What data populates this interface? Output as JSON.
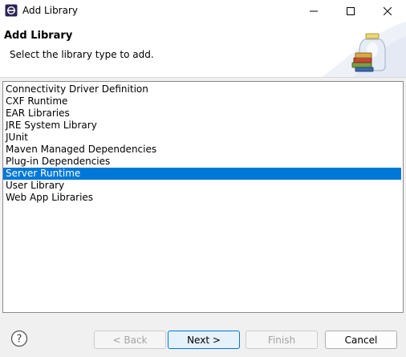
{
  "window": {
    "title": "Add Library",
    "icon": "eclipse-icon"
  },
  "banner": {
    "title": "Add Library",
    "description": "Select the library type to add.",
    "image": "books-jar-icon"
  },
  "library_types": [
    {
      "label": "Connectivity Driver Definition",
      "selected": false
    },
    {
      "label": "CXF Runtime",
      "selected": false
    },
    {
      "label": "EAR Libraries",
      "selected": false
    },
    {
      "label": "JRE System Library",
      "selected": false
    },
    {
      "label": "JUnit",
      "selected": false
    },
    {
      "label": "Maven Managed Dependencies",
      "selected": false
    },
    {
      "label": "Plug-in Dependencies",
      "selected": false
    },
    {
      "label": "Server Runtime",
      "selected": true
    },
    {
      "label": "User Library",
      "selected": false
    },
    {
      "label": "Web App Libraries",
      "selected": false
    }
  ],
  "footer": {
    "help_icon": "help-icon",
    "back_label": "< Back",
    "back_enabled": false,
    "next_label": "Next >",
    "next_enabled": true,
    "finish_label": "Finish",
    "finish_enabled": false,
    "cancel_label": "Cancel",
    "cancel_enabled": true
  },
  "colors": {
    "selection": "#0078d7",
    "banner_bg": "#ffffff",
    "dialog_bg": "#f0f0f0"
  }
}
